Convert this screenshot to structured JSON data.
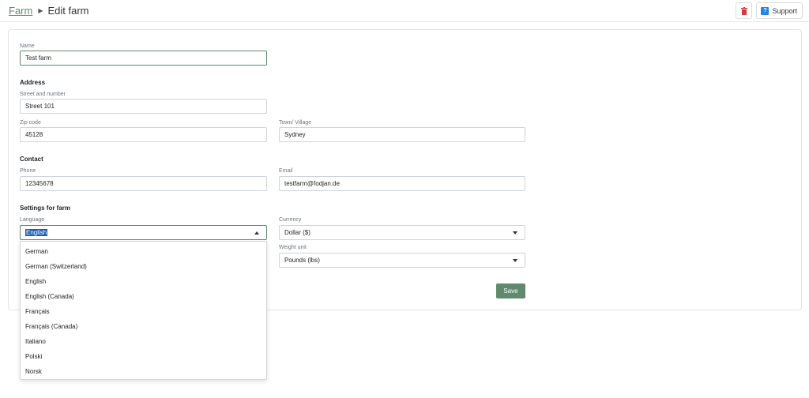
{
  "breadcrumb": {
    "parent": "Farm",
    "current": "Edit farm"
  },
  "header": {
    "support_label": "Support",
    "delete_icon": "trash-icon",
    "support_icon": "help-icon"
  },
  "form": {
    "name": {
      "label": "Name",
      "value": "Test farm"
    },
    "address": {
      "title": "Address",
      "street": {
        "label": "Street and number",
        "value": "Street 101"
      },
      "zip": {
        "label": "Zip code",
        "value": "45128"
      },
      "town": {
        "label": "Town/ Village",
        "value": "Sydney"
      }
    },
    "contact": {
      "title": "Contact",
      "phone": {
        "label": "Phone",
        "value": "12345678"
      },
      "email": {
        "label": "Email",
        "value": "testfarm@fodjan.de"
      }
    },
    "settings": {
      "title": "Settings for farm",
      "language": {
        "label": "Language",
        "value": "English"
      },
      "currency": {
        "label": "Currency",
        "value": "Dollar ($)"
      },
      "weight": {
        "label": "Weight unit",
        "value": "Pounds (lbs)"
      }
    },
    "save_label": "Save"
  },
  "language_options": [
    "German",
    "German (Switzerland)",
    "English",
    "English (Canada)",
    "Français",
    "Français (Canada)",
    "Italiano",
    "Polski",
    "Norsk"
  ],
  "colors": {
    "accent": "#5f8a6d",
    "delete": "#d9363e",
    "support": "#1e88e5",
    "selection": "#1a5fb4"
  }
}
